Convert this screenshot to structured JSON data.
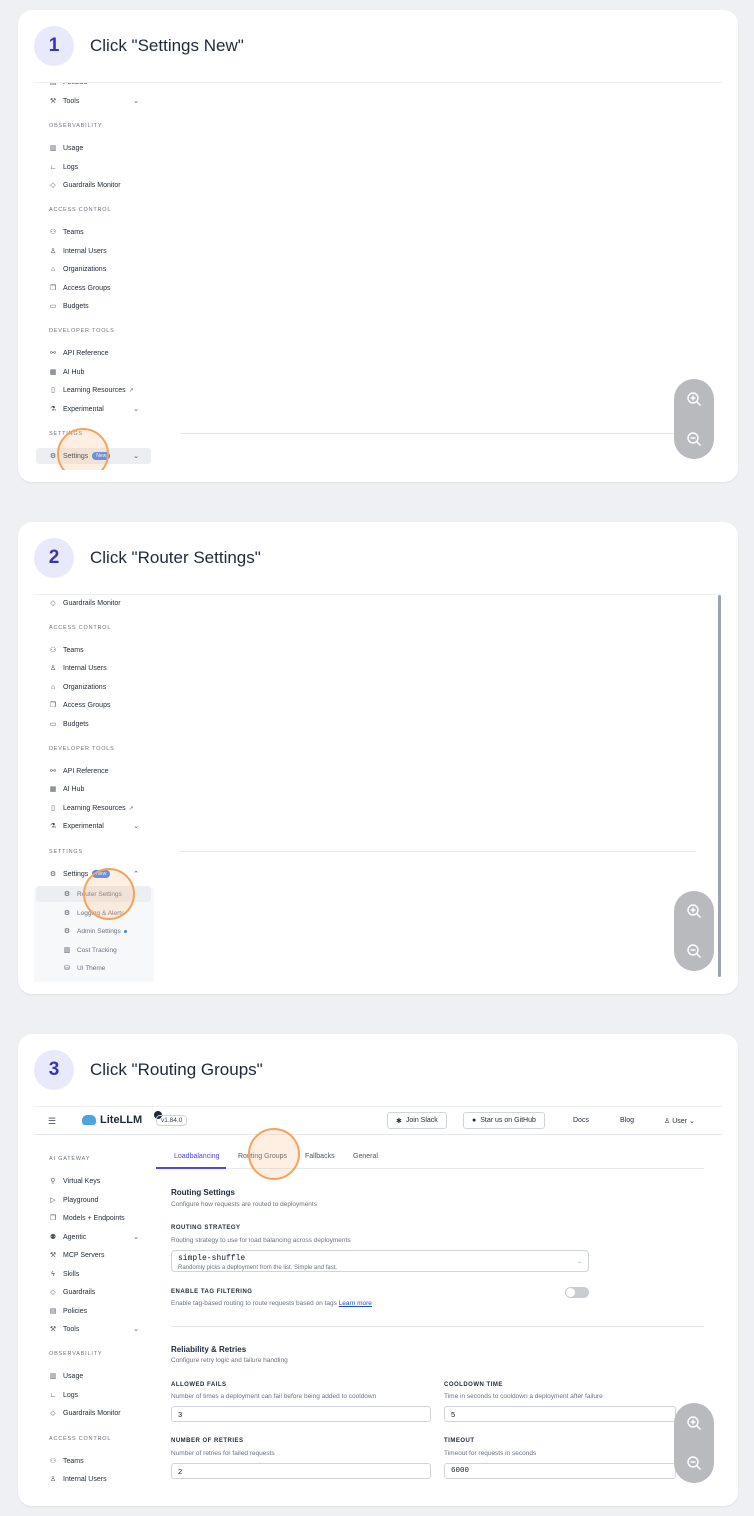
{
  "steps": [
    {
      "number": "1",
      "title": "Click \"Settings New\""
    },
    {
      "number": "2",
      "title": "Click \"Router Settings\""
    },
    {
      "number": "3",
      "title": "Click \"Routing Groups\""
    }
  ],
  "sidebar": {
    "policies": "Policies",
    "tools": "Tools",
    "observability": "OBSERVABILITY",
    "usage": "Usage",
    "logs": "Logs",
    "guardrails_monitor": "Guardrails Monitor",
    "access_control": "ACCESS CONTROL",
    "teams": "Teams",
    "internal_users": "Internal Users",
    "organizations": "Organizations",
    "access_groups": "Access Groups",
    "budgets": "Budgets",
    "developer_tools": "DEVELOPER TOOLS",
    "api_reference": "API Reference",
    "ai_hub": "AI Hub",
    "learning_resources": "Learning Resources",
    "experimental": "Experimental",
    "settings_section": "SETTINGS",
    "settings": "Settings",
    "new_badge": "New",
    "router_settings": "Router Settings",
    "logging_alerts": "Logging & Alerts",
    "admin_settings": "Admin Settings",
    "cost_tracking": "Cost Tracking",
    "ui_theme": "UI Theme",
    "ai_gateway": "AI GATEWAY",
    "virtual_keys": "Virtual Keys",
    "playground": "Playground",
    "models_endpoints": "Models + Endpoints",
    "agentic": "Agentic",
    "mcp_servers": "MCP Servers",
    "skills": "Skills",
    "guardrails": "Guardrails"
  },
  "topbar": {
    "logo": "LiteLLM",
    "version": "v1.84.0",
    "join_slack": "Join Slack",
    "star_github": "Star us on GitHub",
    "docs": "Docs",
    "blog": "Blog",
    "user": "User"
  },
  "tabs": {
    "loadbalancing": "Loadbalancing",
    "routing_groups": "Routing Groups",
    "fallbacks": "Fallbacks",
    "general": "General"
  },
  "routing": {
    "title": "Routing Settings",
    "subtitle": "Configure how requests are routed to deployments",
    "strategy_label": "ROUTING STRATEGY",
    "strategy_desc": "Routing strategy to use for load balancing across deployments",
    "strategy_value": "simple-shuffle",
    "strategy_value_desc": "Randomly picks a deployment from the list. Simple and fast.",
    "tag_label": "ENABLE TAG FILTERING",
    "tag_desc": "Enable tag-based routing to route requests based on tags",
    "learn_more": "Learn more"
  },
  "reliability": {
    "title": "Reliability & Retries",
    "subtitle": "Configure retry logic and failure handling",
    "allowed_fails_label": "ALLOWED FAILS",
    "allowed_fails_desc": "Number of times a deployment can fail before being added to cooldown",
    "allowed_fails_value": "3",
    "cooldown_label": "COOLDOWN TIME",
    "cooldown_desc": "Time in seconds to cooldown a deployment after failure",
    "cooldown_value": "5",
    "retries_label": "NUMBER OF RETRIES",
    "retries_desc": "Number of retries for failed requests",
    "retries_value": "2",
    "timeout_label": "TIMEOUT",
    "timeout_desc": "Timeout for requests in seconds",
    "timeout_value": "6000"
  },
  "icons": {
    "zoom_in": "zoom-in-icon",
    "zoom_out": "zoom-out-icon"
  }
}
